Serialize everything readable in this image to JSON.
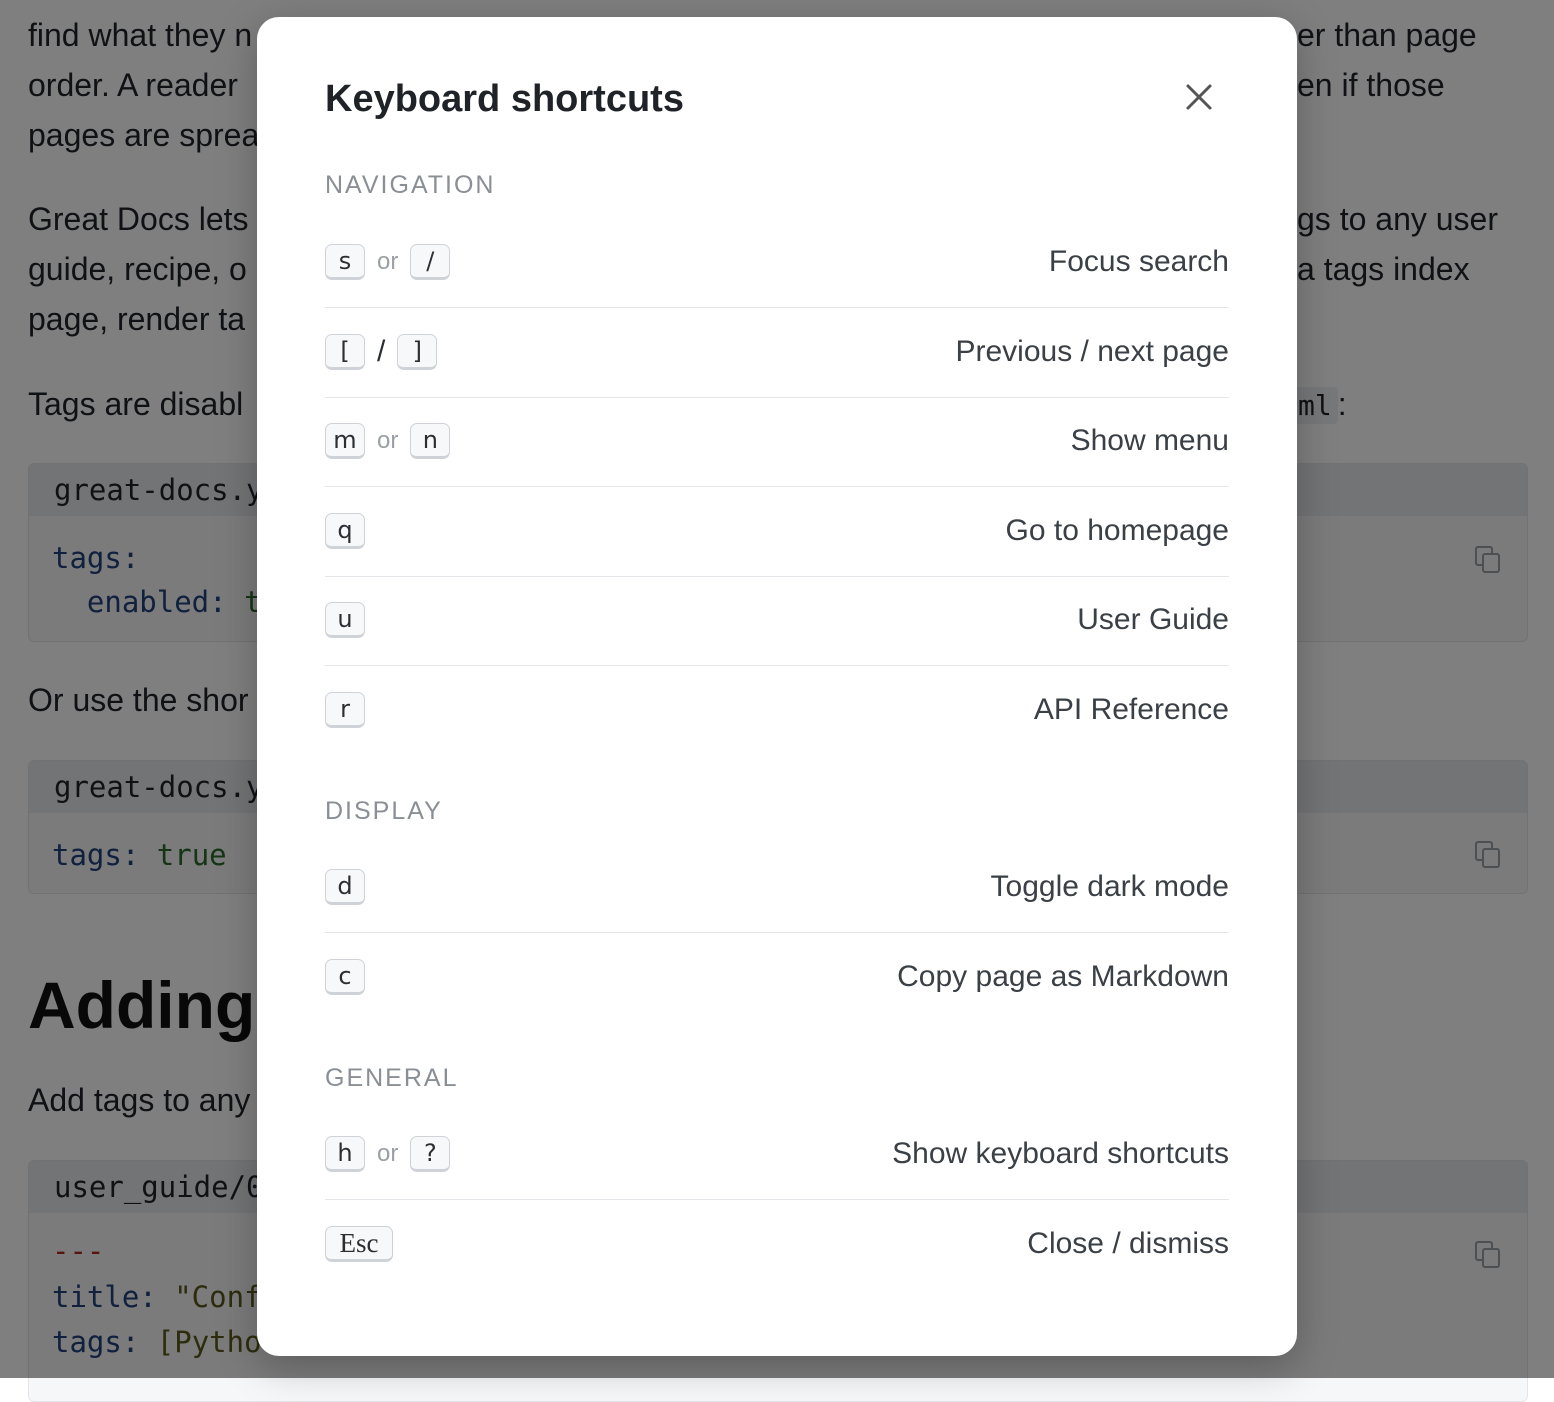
{
  "background": {
    "paragraphs": [
      "find what they n",
      "order. A reader",
      "pages are sprea",
      "Great Docs lets",
      "guide, recipe, o",
      "page, render ta",
      "Tags are disabl"
    ],
    "right_fragments": [
      "er than page",
      "en if those",
      "gs to any user",
      "a tags index"
    ],
    "inline_code": "ml",
    "inline_code_suffix": ":",
    "code_blocks": [
      {
        "file": "great-docs.y",
        "line1_key": "tags:",
        "line2_key": "  enabled:",
        "line2_val": " t"
      },
      {
        "file": "great-docs.y",
        "line1_key": "tags:",
        "line1_val": " true"
      },
      {
        "file": "user_guide/0",
        "line1_dash": "---",
        "line2_key": "title:",
        "line2_val": " \"Conf",
        "line3_key": "tags:",
        "line3_val": " [Pytho"
      }
    ],
    "or_use_text": "Or use the shor",
    "heading": "Adding",
    "add_tags_text": "Add tags to any"
  },
  "modal": {
    "title": "Keyboard shortcuts",
    "close_icon": "close-icon",
    "sections": [
      {
        "title": "NAVIGATION",
        "rows": [
          {
            "keys": [
              "s",
              "/"
            ],
            "separator": "or",
            "label": "Focus search"
          },
          {
            "keys": [
              "[",
              "]"
            ],
            "separator": "/",
            "label": "Previous / next page"
          },
          {
            "keys": [
              "m",
              "n"
            ],
            "separator": "or",
            "label": "Show menu"
          },
          {
            "keys": [
              "q"
            ],
            "label": "Go to homepage"
          },
          {
            "keys": [
              "u"
            ],
            "label": "User Guide"
          },
          {
            "keys": [
              "r"
            ],
            "label": "API Reference"
          }
        ]
      },
      {
        "title": "DISPLAY",
        "rows": [
          {
            "keys": [
              "d"
            ],
            "label": "Toggle dark mode"
          },
          {
            "keys": [
              "c"
            ],
            "label": "Copy page as Markdown"
          }
        ]
      },
      {
        "title": "GENERAL",
        "rows": [
          {
            "keys": [
              "h",
              "?"
            ],
            "separator": "or",
            "label": "Show keyboard shortcuts"
          },
          {
            "keys": [
              "Esc"
            ],
            "label": "Close / dismiss"
          }
        ]
      }
    ]
  },
  "colors": {
    "overlay": "#808080",
    "modal_bg": "#ffffff",
    "section_title": "#8a8f96",
    "code_key": "#20407a",
    "code_value": "#2d6a2d"
  }
}
